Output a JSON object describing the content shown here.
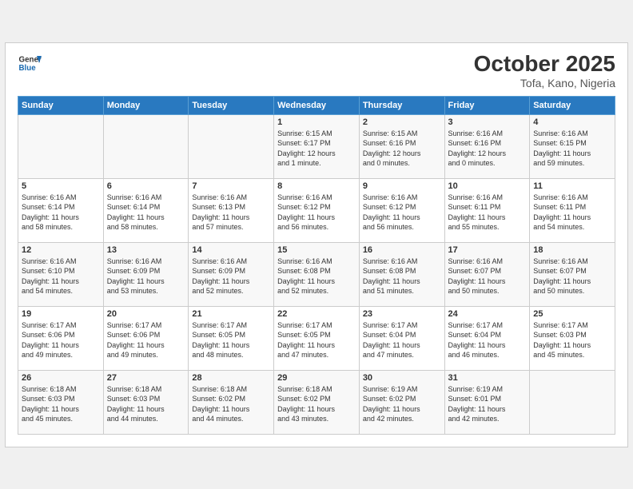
{
  "header": {
    "logo_line1": "General",
    "logo_line2": "Blue",
    "month": "October 2025",
    "location": "Tofa, Kano, Nigeria"
  },
  "weekdays": [
    "Sunday",
    "Monday",
    "Tuesday",
    "Wednesday",
    "Thursday",
    "Friday",
    "Saturday"
  ],
  "weeks": [
    [
      {
        "day": "",
        "info": ""
      },
      {
        "day": "",
        "info": ""
      },
      {
        "day": "",
        "info": ""
      },
      {
        "day": "1",
        "info": "Sunrise: 6:15 AM\nSunset: 6:17 PM\nDaylight: 12 hours\nand 1 minute."
      },
      {
        "day": "2",
        "info": "Sunrise: 6:15 AM\nSunset: 6:16 PM\nDaylight: 12 hours\nand 0 minutes."
      },
      {
        "day": "3",
        "info": "Sunrise: 6:16 AM\nSunset: 6:16 PM\nDaylight: 12 hours\nand 0 minutes."
      },
      {
        "day": "4",
        "info": "Sunrise: 6:16 AM\nSunset: 6:15 PM\nDaylight: 11 hours\nand 59 minutes."
      }
    ],
    [
      {
        "day": "5",
        "info": "Sunrise: 6:16 AM\nSunset: 6:14 PM\nDaylight: 11 hours\nand 58 minutes."
      },
      {
        "day": "6",
        "info": "Sunrise: 6:16 AM\nSunset: 6:14 PM\nDaylight: 11 hours\nand 58 minutes."
      },
      {
        "day": "7",
        "info": "Sunrise: 6:16 AM\nSunset: 6:13 PM\nDaylight: 11 hours\nand 57 minutes."
      },
      {
        "day": "8",
        "info": "Sunrise: 6:16 AM\nSunset: 6:12 PM\nDaylight: 11 hours\nand 56 minutes."
      },
      {
        "day": "9",
        "info": "Sunrise: 6:16 AM\nSunset: 6:12 PM\nDaylight: 11 hours\nand 56 minutes."
      },
      {
        "day": "10",
        "info": "Sunrise: 6:16 AM\nSunset: 6:11 PM\nDaylight: 11 hours\nand 55 minutes."
      },
      {
        "day": "11",
        "info": "Sunrise: 6:16 AM\nSunset: 6:11 PM\nDaylight: 11 hours\nand 54 minutes."
      }
    ],
    [
      {
        "day": "12",
        "info": "Sunrise: 6:16 AM\nSunset: 6:10 PM\nDaylight: 11 hours\nand 54 minutes."
      },
      {
        "day": "13",
        "info": "Sunrise: 6:16 AM\nSunset: 6:09 PM\nDaylight: 11 hours\nand 53 minutes."
      },
      {
        "day": "14",
        "info": "Sunrise: 6:16 AM\nSunset: 6:09 PM\nDaylight: 11 hours\nand 52 minutes."
      },
      {
        "day": "15",
        "info": "Sunrise: 6:16 AM\nSunset: 6:08 PM\nDaylight: 11 hours\nand 52 minutes."
      },
      {
        "day": "16",
        "info": "Sunrise: 6:16 AM\nSunset: 6:08 PM\nDaylight: 11 hours\nand 51 minutes."
      },
      {
        "day": "17",
        "info": "Sunrise: 6:16 AM\nSunset: 6:07 PM\nDaylight: 11 hours\nand 50 minutes."
      },
      {
        "day": "18",
        "info": "Sunrise: 6:16 AM\nSunset: 6:07 PM\nDaylight: 11 hours\nand 50 minutes."
      }
    ],
    [
      {
        "day": "19",
        "info": "Sunrise: 6:17 AM\nSunset: 6:06 PM\nDaylight: 11 hours\nand 49 minutes."
      },
      {
        "day": "20",
        "info": "Sunrise: 6:17 AM\nSunset: 6:06 PM\nDaylight: 11 hours\nand 49 minutes."
      },
      {
        "day": "21",
        "info": "Sunrise: 6:17 AM\nSunset: 6:05 PM\nDaylight: 11 hours\nand 48 minutes."
      },
      {
        "day": "22",
        "info": "Sunrise: 6:17 AM\nSunset: 6:05 PM\nDaylight: 11 hours\nand 47 minutes."
      },
      {
        "day": "23",
        "info": "Sunrise: 6:17 AM\nSunset: 6:04 PM\nDaylight: 11 hours\nand 47 minutes."
      },
      {
        "day": "24",
        "info": "Sunrise: 6:17 AM\nSunset: 6:04 PM\nDaylight: 11 hours\nand 46 minutes."
      },
      {
        "day": "25",
        "info": "Sunrise: 6:17 AM\nSunset: 6:03 PM\nDaylight: 11 hours\nand 45 minutes."
      }
    ],
    [
      {
        "day": "26",
        "info": "Sunrise: 6:18 AM\nSunset: 6:03 PM\nDaylight: 11 hours\nand 45 minutes."
      },
      {
        "day": "27",
        "info": "Sunrise: 6:18 AM\nSunset: 6:03 PM\nDaylight: 11 hours\nand 44 minutes."
      },
      {
        "day": "28",
        "info": "Sunrise: 6:18 AM\nSunset: 6:02 PM\nDaylight: 11 hours\nand 44 minutes."
      },
      {
        "day": "29",
        "info": "Sunrise: 6:18 AM\nSunset: 6:02 PM\nDaylight: 11 hours\nand 43 minutes."
      },
      {
        "day": "30",
        "info": "Sunrise: 6:19 AM\nSunset: 6:02 PM\nDaylight: 11 hours\nand 42 minutes."
      },
      {
        "day": "31",
        "info": "Sunrise: 6:19 AM\nSunset: 6:01 PM\nDaylight: 11 hours\nand 42 minutes."
      },
      {
        "day": "",
        "info": ""
      }
    ]
  ]
}
